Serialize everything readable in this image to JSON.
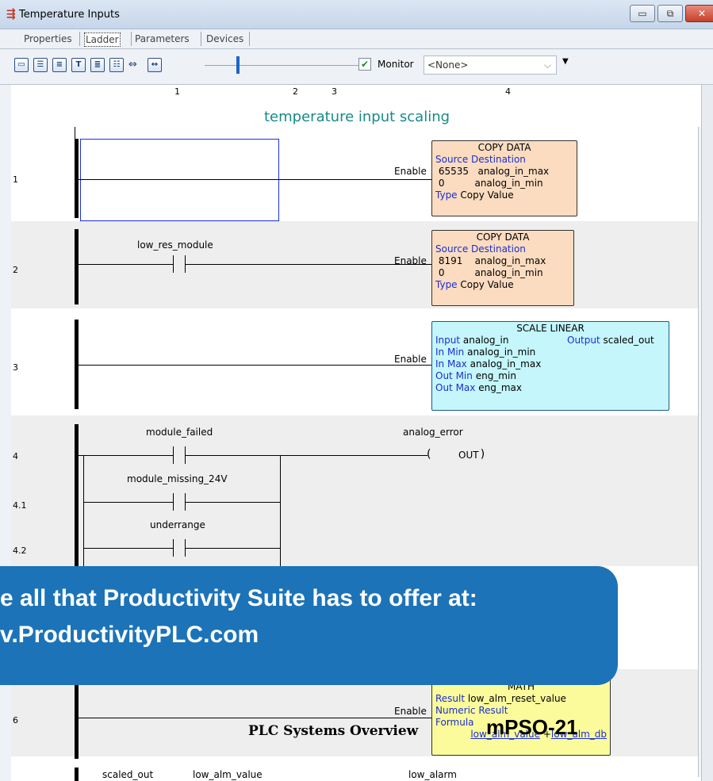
{
  "window": {
    "title": "Temperature Inputs",
    "app_icon": "ladder-app-icon",
    "buttons": [
      "minimize",
      "restore",
      "close"
    ]
  },
  "tabs": [
    {
      "label": "Properties"
    },
    {
      "label": "Ladder"
    },
    {
      "label": "Parameters"
    },
    {
      "label": "Devices"
    }
  ],
  "toolbar": {
    "icons": [
      "rung-view-icon",
      "instruction-list-icon",
      "outline-icon",
      "tag-text-icon",
      "comment-icon",
      "tree-icon",
      "arrows-icon",
      "fit-width-icon"
    ],
    "tb_glyphs": [
      "▭",
      "☰",
      "≡",
      "T",
      "≣",
      "☷"
    ],
    "arrows_glyph": "⇔",
    "fit_glyph": "↔",
    "monitor_label": "Monitor",
    "monitor_value": "<None>"
  },
  "columns": [
    "1",
    "2",
    "3",
    "4"
  ],
  "heading": "temperature input scaling",
  "rungs": [
    {
      "number": "1"
    },
    {
      "number": "2",
      "contact": "low_res_module"
    },
    {
      "number": "3"
    },
    {
      "number": "4",
      "contact": "module_failed",
      "coil": "analog_error",
      "coil_text": "OUT"
    },
    {
      "number": "4.1",
      "contact": "module_missing_24V"
    },
    {
      "number": "4.2",
      "contact": "underrange"
    },
    {
      "number": "6"
    },
    {
      "contact": "scaled_out",
      "contact2": "low_alm_value",
      "coil": "low_alarm"
    }
  ],
  "enable_label": "Enable",
  "copy1": {
    "title": "COPY DATA",
    "hdr_src": "Source",
    "hdr_dst": "Destination",
    "r1_src": "65535",
    "r1_dst": "analog_in_max",
    "r2_src": "0",
    "r2_dst": "analog_in_min",
    "type_label": "Type",
    "type_value": "Copy Value"
  },
  "copy2": {
    "title": "COPY DATA",
    "hdr_src": "Source",
    "hdr_dst": "Destination",
    "r1_src": "8191",
    "r1_dst": "analog_in_max",
    "r2_src": "0",
    "r2_dst": "analog_in_min",
    "type_label": "Type",
    "type_value": "Copy Value"
  },
  "scale": {
    "title": "SCALE LINEAR",
    "input_label": "Input",
    "input_value": "analog_in",
    "output_label": "Output",
    "output_value": "scaled_out",
    "inmin_label": "In Min",
    "inmin_value": "analog_in_min",
    "inmax_label": "In Max",
    "inmax_value": "analog_in_max",
    "outmin_label": "Out Min",
    "outmin_value": "eng_min",
    "outmax_label": "Out Max",
    "outmax_value": "eng_max"
  },
  "math": {
    "title": "MATH",
    "result_label": "Result",
    "result_value": "low_alm_reset_value",
    "numeric": "Numeric Result",
    "formula_label": "Formula",
    "f1": "low_alm_value",
    "op": "+",
    "f2": "low_alm_db"
  },
  "banner": {
    "line1": "e all that Productivity Suite has to offer at:",
    "line2": "v.ProductivityPLC.com",
    "color": "#1c73b8"
  },
  "footer": {
    "text1": "PLC Systems Overview",
    "text2": "mPSO-21"
  }
}
